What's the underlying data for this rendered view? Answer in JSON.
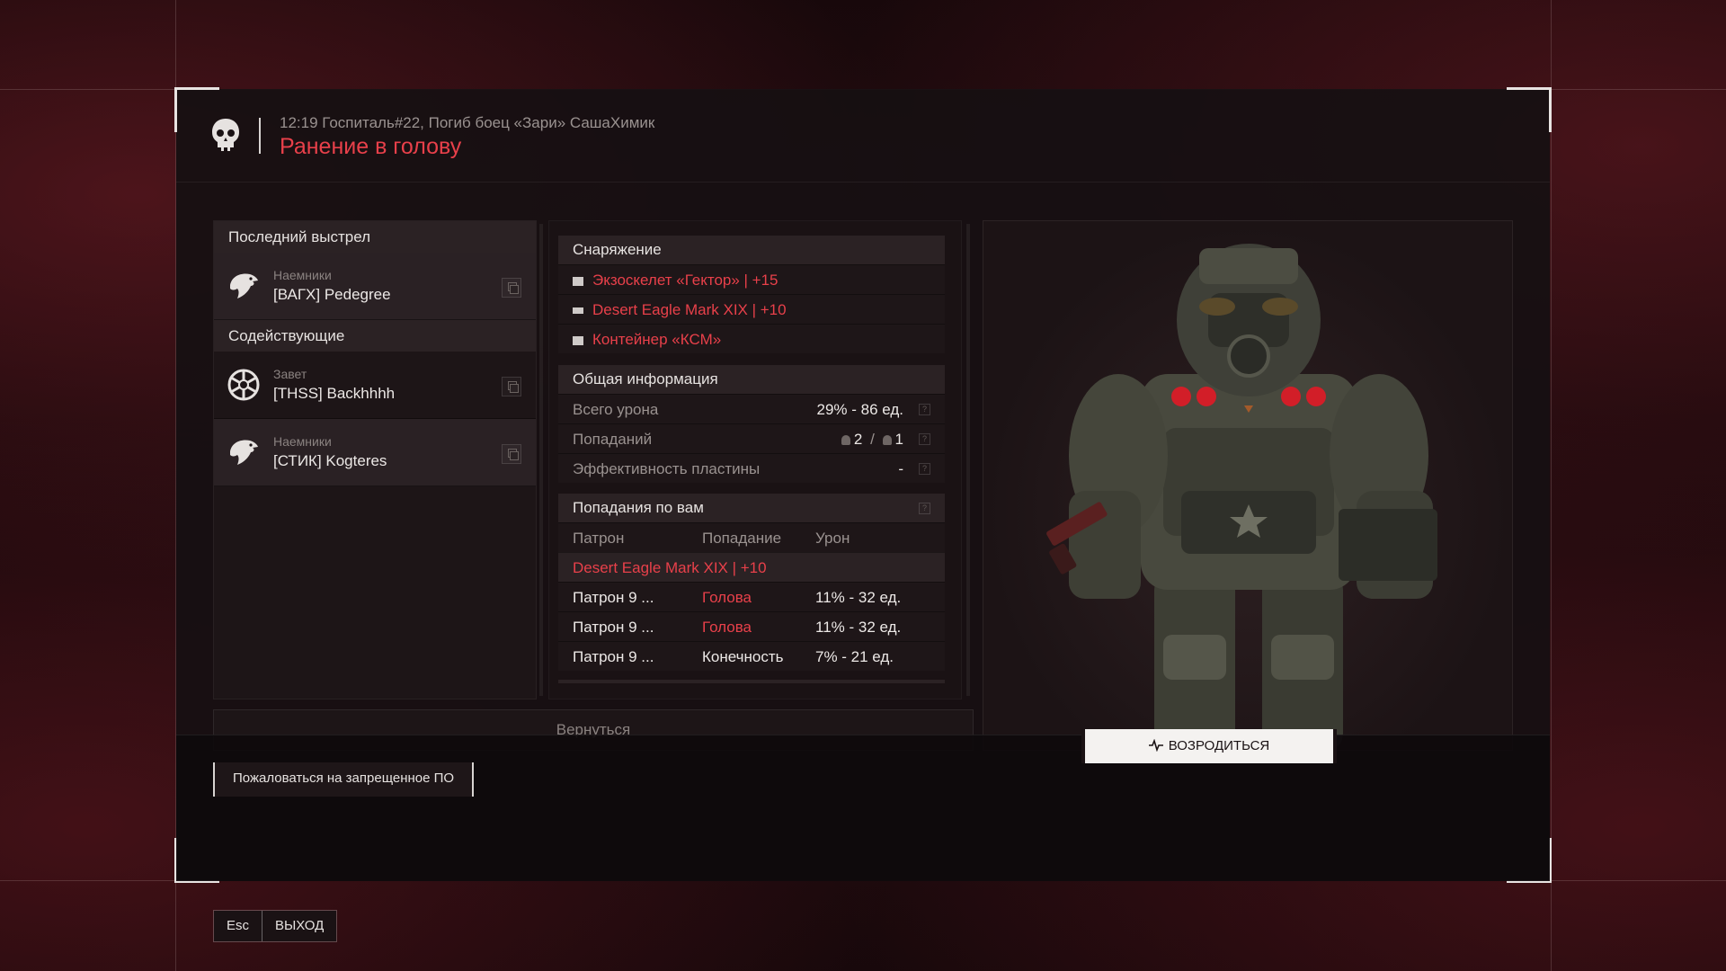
{
  "header": {
    "subtitle": "12:19 Госпиталь#22, Погиб боец «Зари» СашаХимик",
    "title": "Ранение в голову"
  },
  "left_panel": {
    "last_shot_title": "Последний выстрел",
    "last_shot": {
      "faction": "Наемники",
      "name": "[ВАГХ] Pedegree",
      "icon": "eagle-icon"
    },
    "assist_title": "Содействующие",
    "assists": [
      {
        "faction": "Завет",
        "name": "[THSS] Backhhhh",
        "icon": "covenant-icon"
      },
      {
        "faction": "Наемники",
        "name": "[СТИК] Kogteres",
        "icon": "eagle-icon"
      }
    ]
  },
  "equipment": {
    "title": "Снаряжение",
    "items": [
      {
        "label": "Экзоскелет «Гектор» | +15",
        "icon": "armor-icon"
      },
      {
        "label": "Desert Eagle Mark XIX | +10",
        "icon": "pistol-icon"
      },
      {
        "label": "Контейнер «КСМ»",
        "icon": "container-icon"
      }
    ]
  },
  "general": {
    "title": "Общая информация",
    "rows": [
      {
        "label": "Всего урона",
        "value": "29% - 86 ед."
      },
      {
        "label": "Попаданий",
        "value_a": "2",
        "sep": "/",
        "value_b": "1"
      },
      {
        "label": "Эффективность пластины",
        "value": "-"
      }
    ],
    "help": "?"
  },
  "hits": {
    "title": "Попадания по вам",
    "columns": [
      "Патрон",
      "Попадание",
      "Урон"
    ],
    "weapon": "Desert Eagle Mark XIX | +10",
    "rows": [
      {
        "ammo": "Патрон 9 ...",
        "hit": "Голова",
        "damage": "11% - 32 ед.",
        "hit_red": true
      },
      {
        "ammo": "Патрон 9 ...",
        "hit": "Голова",
        "damage": "11% - 32 ед.",
        "hit_red": true
      },
      {
        "ammo": "Патрон 9 ...",
        "hit": "Конечность",
        "damage": "7% - 21 ед.",
        "hit_red": false
      }
    ]
  },
  "buttons": {
    "back": "Вернуться",
    "report": "Пожаловаться на запрещенное ПО",
    "respawn": "ВОЗРОДИТЬСЯ",
    "esc_key": "Esc",
    "exit": "ВЫХОД"
  },
  "colors": {
    "accent": "#e8404a",
    "panel": "#2b2224",
    "background": "#1a090c"
  }
}
